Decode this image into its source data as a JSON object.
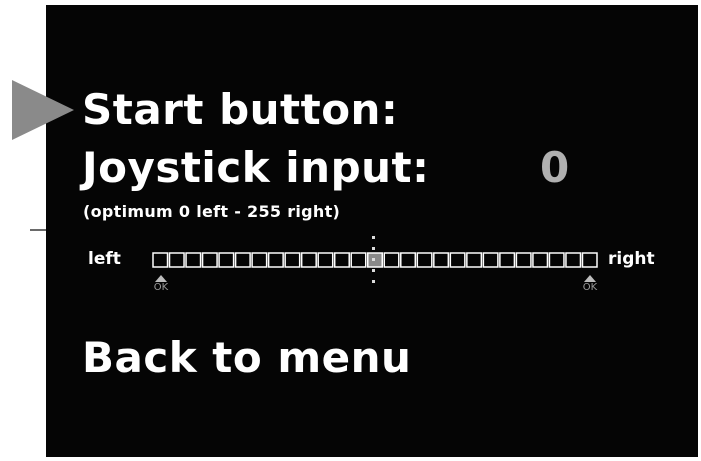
{
  "menu": {
    "start_label": "Start button:",
    "joystick_label": "Joystick input:",
    "joystick_value": "0",
    "range_hint": "(optimum 0 left - 255 right)",
    "back_label": "Back to menu"
  },
  "meter": {
    "left_label": "left",
    "right_label": "right",
    "segments": 27,
    "active_segment": 13,
    "ok_left": "OK",
    "ok_right": "OK"
  },
  "colors": {
    "background": "#050505",
    "text": "#ffffff",
    "pointer": "#8a8a8a",
    "value": "#b0b0b0"
  }
}
